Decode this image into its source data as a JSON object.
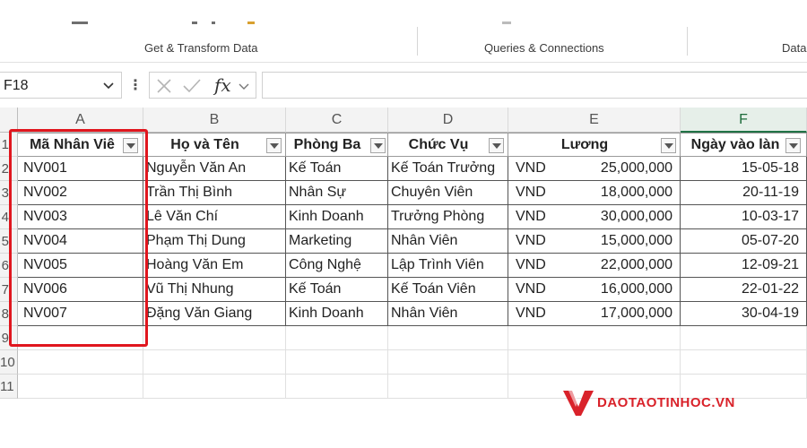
{
  "ribbon": {
    "groups": [
      "Get & Transform Data",
      "Queries & Connections",
      "Data"
    ]
  },
  "formula_bar": {
    "name_box": "F18",
    "fx_label": "fx",
    "formula": ""
  },
  "columns": [
    "A",
    "B",
    "C",
    "D",
    "E",
    "F"
  ],
  "rows": [
    "1",
    "2",
    "3",
    "4",
    "5",
    "6",
    "7",
    "8",
    "9",
    "10",
    "11"
  ],
  "table": {
    "headers": [
      "Mã Nhân Viê",
      "Họ và Tên",
      "Phòng Ba",
      "Chức Vụ",
      "Lương",
      "Ngày vào làn"
    ],
    "records": [
      {
        "id": "NV001",
        "name": "Nguyễn Văn An",
        "dept": "Kế Toán",
        "role": "Kế Toán Trưởng",
        "currency": "VND",
        "salary": "25,000,000",
        "date": "15-05-18"
      },
      {
        "id": "NV002",
        "name": "Trần Thị Bình",
        "dept": "Nhân Sự",
        "role": "Chuyên Viên",
        "currency": "VND",
        "salary": "18,000,000",
        "date": "20-11-19"
      },
      {
        "id": "NV003",
        "name": "Lê Văn Chí",
        "dept": "Kinh Doanh",
        "role": "Trưởng Phòng",
        "currency": "VND",
        "salary": "30,000,000",
        "date": "10-03-17"
      },
      {
        "id": "NV004",
        "name": "Phạm Thị Dung",
        "dept": "Marketing",
        "role": "Nhân Viên",
        "currency": "VND",
        "salary": "15,000,000",
        "date": "05-07-20"
      },
      {
        "id": "NV005",
        "name": "Hoàng Văn Em",
        "dept": "Công Nghệ",
        "role": "Lập Trình Viên",
        "currency": "VND",
        "salary": "22,000,000",
        "date": "12-09-21"
      },
      {
        "id": "NV006",
        "name": "Vũ Thị Nhung",
        "dept": "Kế Toán",
        "role": "Kế Toán Viên",
        "currency": "VND",
        "salary": "16,000,000",
        "date": "22-01-22"
      },
      {
        "id": "NV007",
        "name": "Đặng Văn Giang",
        "dept": "Kinh Doanh",
        "role": "Nhân Viên",
        "currency": "VND",
        "salary": "17,000,000",
        "date": "30-04-19"
      }
    ]
  },
  "watermark": {
    "text": "DAOTAOTINHOC.VN",
    "color": "#d9222a"
  },
  "colors": {
    "highlight": "#e0161e",
    "selected_column": "#217346"
  }
}
